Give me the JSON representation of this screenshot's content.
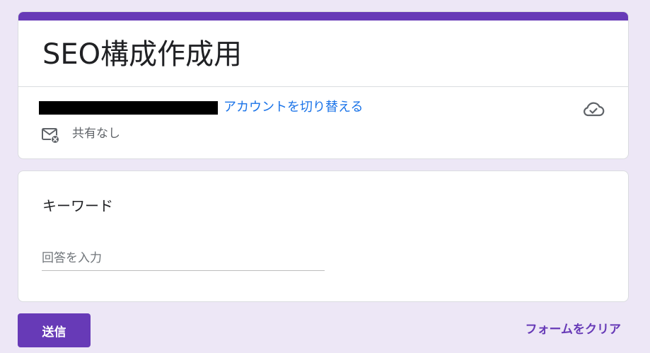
{
  "form": {
    "title": "SEO構成作成用",
    "switch_account_label": "アカウントを切り替える",
    "share_status": "共有なし",
    "icons": {
      "cloud": "cloud-check-icon",
      "mail": "mail-blocked-icon"
    }
  },
  "question": {
    "title": "キーワード",
    "input_value": "",
    "input_placeholder": "回答を入力"
  },
  "actions": {
    "submit_label": "送信",
    "clear_label": "フォームをクリア"
  },
  "colors": {
    "accent": "#673ab7",
    "link": "#1a73e8",
    "background": "#ede7f6"
  }
}
